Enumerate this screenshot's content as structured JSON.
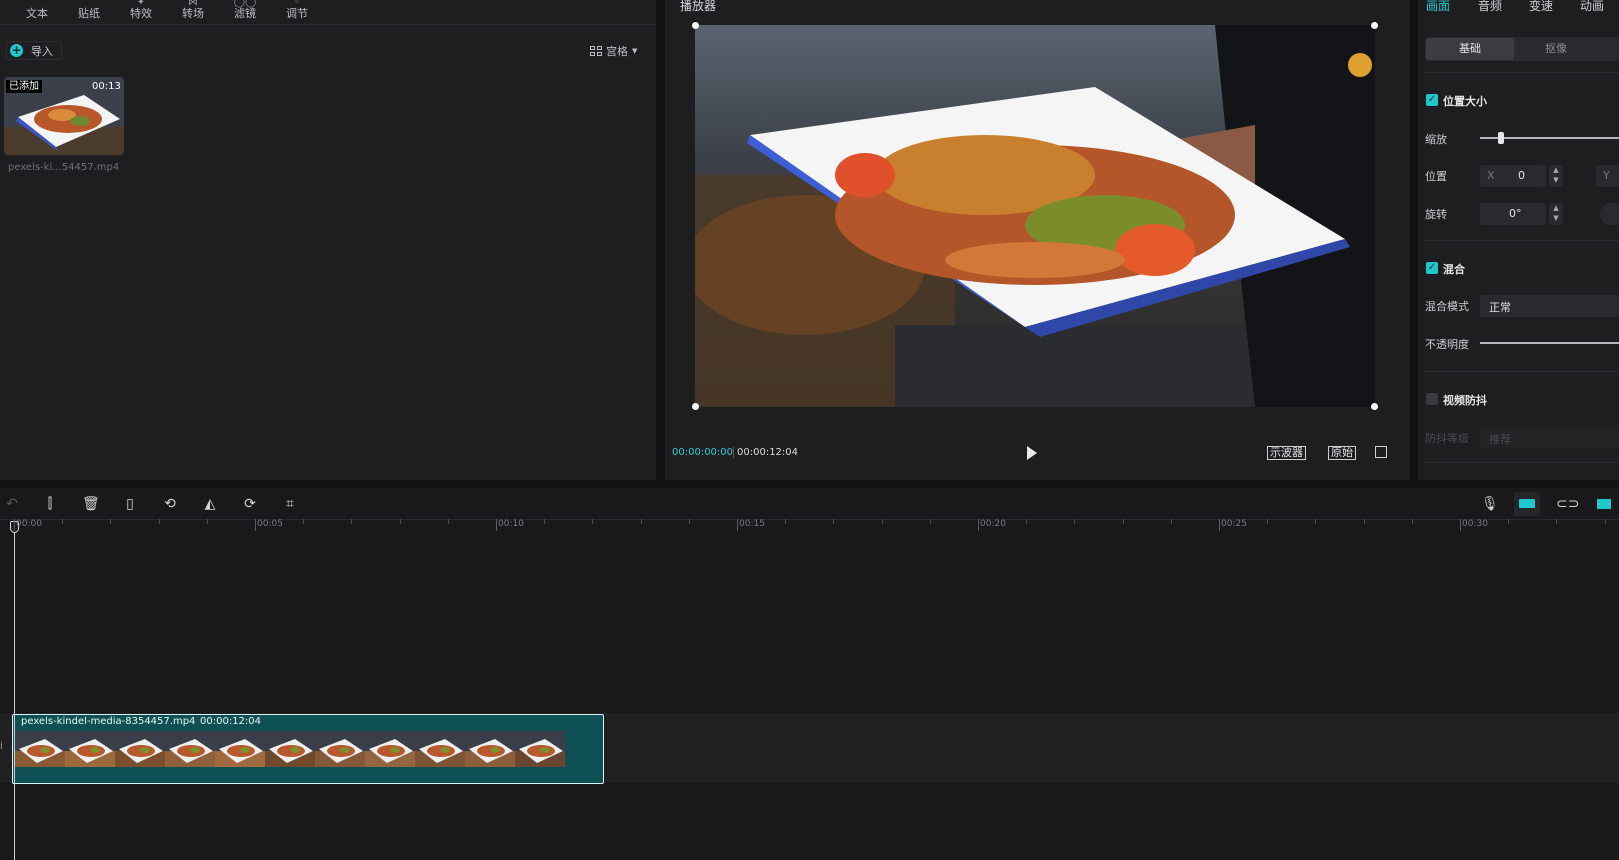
{
  "media_tools": [
    {
      "label": "文本",
      "icon": "text-icon"
    },
    {
      "label": "贴纸",
      "icon": "sticker-icon"
    },
    {
      "label": "特效",
      "icon": "effects-icon"
    },
    {
      "label": "转场",
      "icon": "transition-icon"
    },
    {
      "label": "滤镜",
      "icon": "filter-icon"
    },
    {
      "label": "调节",
      "icon": "adjust-icon"
    }
  ],
  "media": {
    "import_label": "导入",
    "view_label": "宫格",
    "item": {
      "badge": "已添加",
      "duration": "00:13",
      "filename": "pexels-ki...54457.mp4"
    }
  },
  "player": {
    "title": "播放器",
    "current_time": "00:00:00:00",
    "total_time": "00:00:12:04",
    "scope_button": "示波器",
    "ratio_button": "原始"
  },
  "inspector": {
    "tabs": [
      "画面",
      "音频",
      "变速",
      "动画"
    ],
    "active_tab": "画面",
    "subtabs": [
      "基础",
      "抠像"
    ],
    "section_position": "位置大小",
    "scale_label": "缩放",
    "scale_value": 0.15,
    "position_label": "位置",
    "x_label": "X",
    "x_value": "0",
    "y_label": "Y",
    "rotation_label": "旋转",
    "rotation_value": "0°",
    "section_blend": "混合",
    "blend_mode_label": "混合模式",
    "blend_mode_value": "正常",
    "opacity_label": "不透明度",
    "section_stabilize": "视频防抖",
    "stabilize_level_label": "防抖等级",
    "stabilize_level_value": "推荐"
  },
  "timeline": {
    "ruler_labels": [
      "00:00",
      "00:05",
      "00:10",
      "00:15",
      "00:20",
      "00:25",
      "00:30"
    ],
    "clip": {
      "name": "pexels-kindel-media-8354457.mp4",
      "duration": "00:00:12:04"
    },
    "tools_left": [
      "undo-icon",
      "split-icon",
      "delete-icon",
      "freeze-icon",
      "reverse-icon",
      "mirror-icon",
      "rotate-icon",
      "crop-icon"
    ],
    "tools_right": [
      "microphone-icon",
      "main-track-magnet-icon",
      "link-icon",
      "preview-axis-icon"
    ]
  },
  "colors": {
    "accent": "#1fc7cf",
    "clip_fill": "#0f5054",
    "panel": "#1e1e21"
  }
}
